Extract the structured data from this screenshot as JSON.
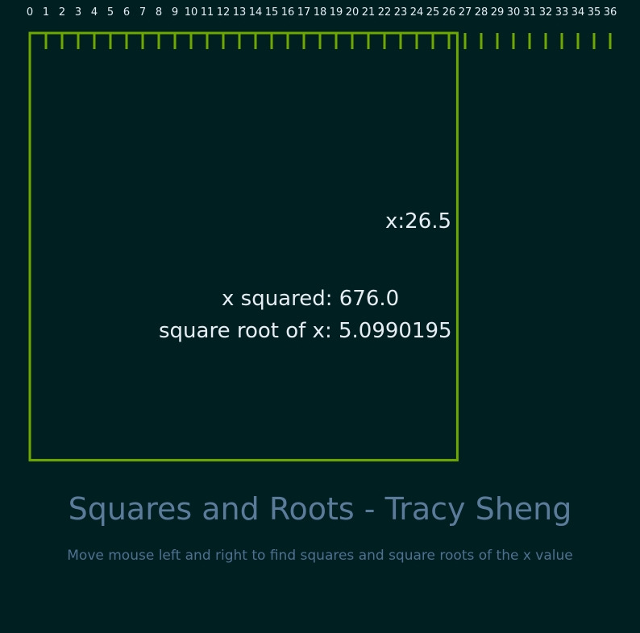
{
  "app": {
    "background": "#001f21",
    "accent": "#6fa800",
    "title": "Squares and Roots - Tracy Sheng",
    "subtitle": "Move mouse left and right to find squares and square roots of the x value"
  },
  "ruler": {
    "labels": [
      "0",
      "1",
      "2",
      "3",
      "4",
      "5",
      "6",
      "7",
      "8",
      "9",
      "10",
      "11",
      "12",
      "13",
      "14",
      "15",
      "16",
      "17",
      "18",
      "19",
      "20",
      "21",
      "22",
      "23",
      "24",
      "25",
      "26",
      "27",
      "28",
      "29",
      "30",
      "31",
      "32",
      "33",
      "34",
      "35",
      "36"
    ]
  },
  "readouts": {
    "x_label": "x:26.5",
    "x_squared_label": "x squared: 676.0",
    "sqrt_label": "square root of x: 5.0990195"
  },
  "state": {
    "x": 26.5,
    "square_side_units": 26
  }
}
